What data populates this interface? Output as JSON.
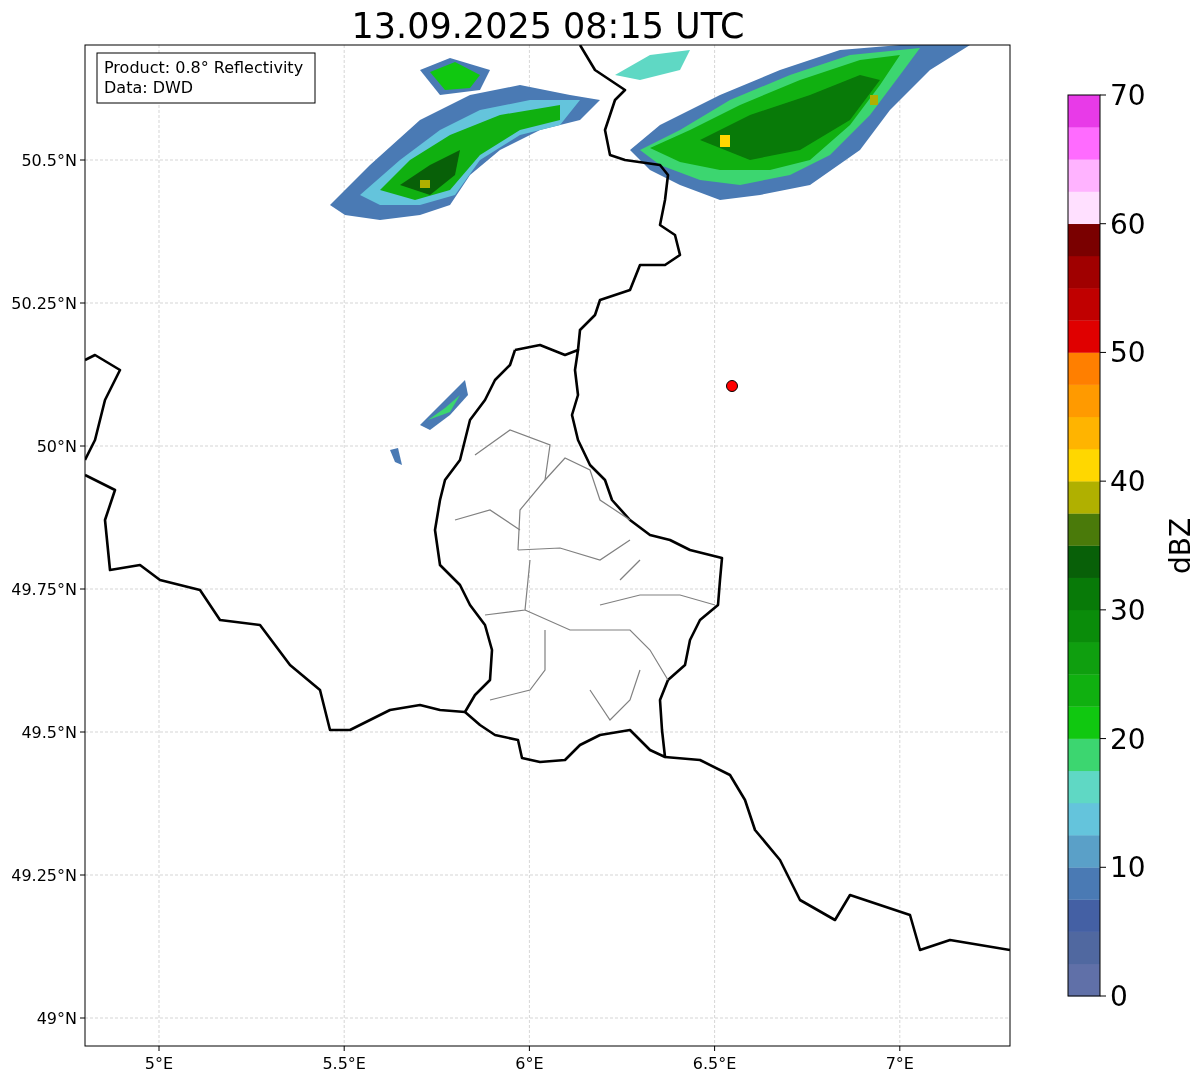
{
  "title": "13.09.2025 08:15 UTC",
  "info_box": {
    "lines": [
      "Product: 0.8° Reflectivity",
      "Data: DWD"
    ]
  },
  "map": {
    "y_ticks": [
      "50.5°N",
      "50.25°N",
      "50°N",
      "49.75°N",
      "49.5°N",
      "49.25°N",
      "49°N"
    ],
    "x_ticks": [
      "5°E",
      "5.5°E",
      "6°E",
      "6.5°E",
      "7°E"
    ]
  },
  "colorbar": {
    "label": "dBZ",
    "ticks": [
      "70",
      "60",
      "50",
      "40",
      "30",
      "20",
      "10",
      "0"
    ],
    "bins": [
      {
        "color": "#6070a8"
      },
      {
        "color": "#5068a0"
      },
      {
        "color": "#4460a4"
      },
      {
        "color": "#4a7ab4"
      },
      {
        "color": "#5aa0c8"
      },
      {
        "color": "#64c4dc"
      },
      {
        "color": "#5fd8c4"
      },
      {
        "color": "#3cd670"
      },
      {
        "color": "#10c810"
      },
      {
        "color": "#10b010"
      },
      {
        "color": "#0f9f0f"
      },
      {
        "color": "#0a8c0a"
      },
      {
        "color": "#087a08"
      },
      {
        "color": "#086008"
      },
      {
        "color": "#4a7a0a"
      },
      {
        "color": "#b0b000"
      },
      {
        "color": "#ffd700"
      },
      {
        "color": "#ffb400"
      },
      {
        "color": "#ff9a00"
      },
      {
        "color": "#ff7f00"
      },
      {
        "color": "#e00000"
      },
      {
        "color": "#c00000"
      },
      {
        "color": "#a00000"
      },
      {
        "color": "#7a0000"
      },
      {
        "color": "#ffe0ff"
      },
      {
        "color": "#ffb3ff"
      },
      {
        "color": "#ff6bff"
      },
      {
        "color": "#e83ae8"
      }
    ]
  }
}
